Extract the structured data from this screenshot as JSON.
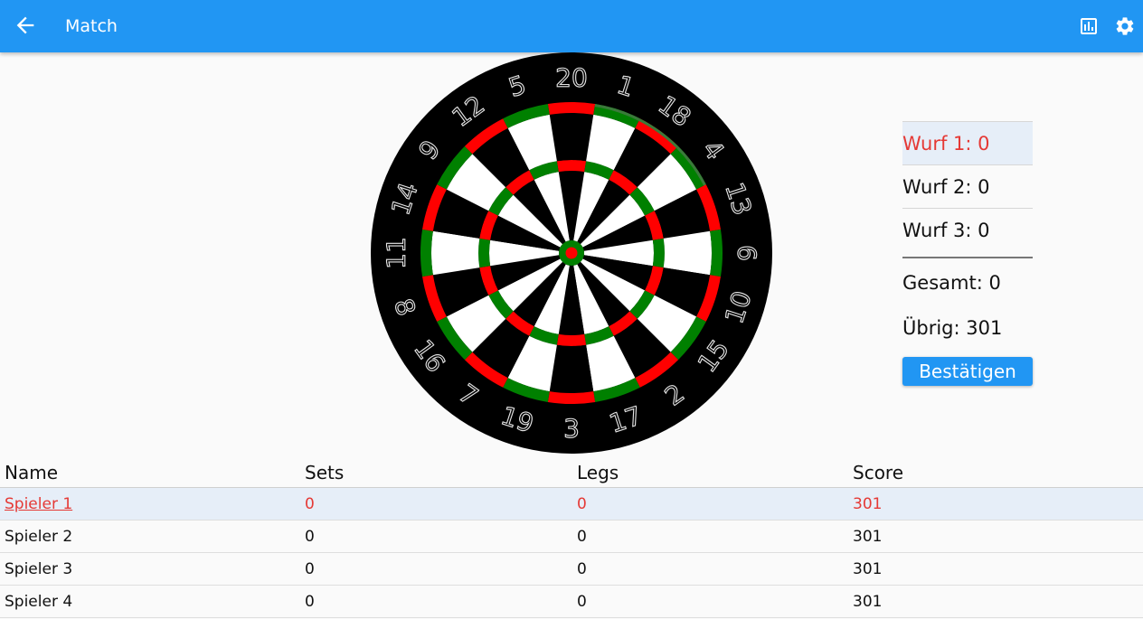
{
  "appbar": {
    "title": "Match",
    "background": "#2196f3",
    "back_icon": "arrow-back-icon",
    "stats_icon": "bar-chart-icon",
    "settings_icon": "gear-icon"
  },
  "dartboard": {
    "numbers": [
      20,
      1,
      18,
      4,
      13,
      6,
      10,
      15,
      2,
      17,
      3,
      19,
      7,
      16,
      8,
      11,
      14,
      9,
      12,
      5
    ],
    "colors": {
      "dark_segment": "#000000",
      "light_segment": "#ffffff",
      "red": "#ff0000",
      "green": "#008000",
      "highlight": "#3a7a3a"
    },
    "highlighted_sectors": [
      1,
      18,
      4
    ]
  },
  "throws": [
    {
      "label": "Wurf 1: 0",
      "active": true
    },
    {
      "label": "Wurf 2: 0",
      "active": false
    },
    {
      "label": "Wurf 3: 0",
      "active": false
    }
  ],
  "summary": {
    "total_label": "Gesamt: 0",
    "remaining_label": "Übrig: 301"
  },
  "confirm_button": "Bestätigen",
  "table": {
    "headers": [
      "Name",
      "Sets",
      "Legs",
      "Score"
    ],
    "rows": [
      {
        "name": "Spieler 1",
        "sets": "0",
        "legs": "0",
        "score": "301",
        "active": true
      },
      {
        "name": "Spieler 2",
        "sets": "0",
        "legs": "0",
        "score": "301",
        "active": false
      },
      {
        "name": "Spieler 3",
        "sets": "0",
        "legs": "0",
        "score": "301",
        "active": false
      },
      {
        "name": "Spieler 4",
        "sets": "0",
        "legs": "0",
        "score": "301",
        "active": false
      }
    ]
  },
  "accent_color": "#e53935"
}
